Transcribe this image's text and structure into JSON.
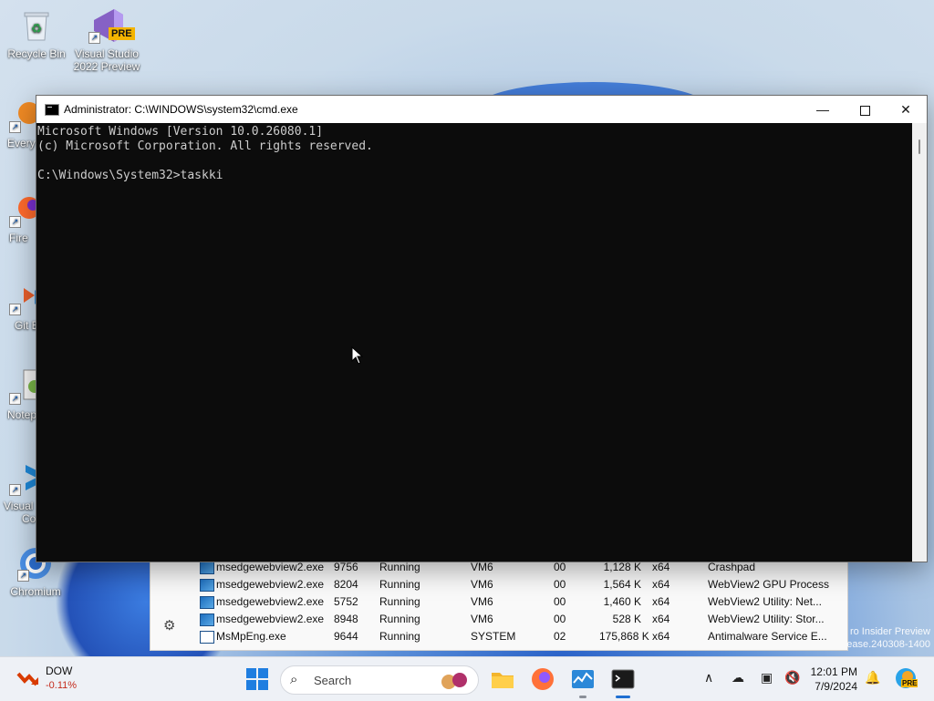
{
  "desktop": {
    "icons": [
      {
        "label": "Recycle Bin"
      },
      {
        "label": "Visual Studio 2022 Preview",
        "badge": "PRE"
      },
      {
        "label": "Every"
      },
      {
        "label": "Fire"
      },
      {
        "label": "Git E"
      },
      {
        "label": "Notep"
      },
      {
        "label": "Visual",
        "label2": "Co"
      },
      {
        "label": "Chromium"
      }
    ]
  },
  "cmd": {
    "title": "Administrator: C:\\WINDOWS\\system32\\cmd.exe",
    "lines": [
      "Microsoft Windows [Version 10.0.26080.1]",
      "(c) Microsoft Corporation. All rights reserved.",
      "",
      "C:\\Windows\\System32>taskki"
    ],
    "controls": {
      "minimize": "—",
      "close": "✕"
    }
  },
  "taskmgr": {
    "rows": [
      {
        "name": "msedgewebview2.exe",
        "pid": "9756",
        "status": "Running",
        "user": "VM6",
        "cpu": "00",
        "mem": "1,128 K",
        "arch": "x64",
        "desc": "Crashpad"
      },
      {
        "name": "msedgewebview2.exe",
        "pid": "8204",
        "status": "Running",
        "user": "VM6",
        "cpu": "00",
        "mem": "1,564 K",
        "arch": "x64",
        "desc": "WebView2 GPU Process"
      },
      {
        "name": "msedgewebview2.exe",
        "pid": "5752",
        "status": "Running",
        "user": "VM6",
        "cpu": "00",
        "mem": "1,460 K",
        "arch": "x64",
        "desc": "WebView2 Utility: Net..."
      },
      {
        "name": "msedgewebview2.exe",
        "pid": "8948",
        "status": "Running",
        "user": "VM6",
        "cpu": "00",
        "mem": "528 K",
        "arch": "x64",
        "desc": "WebView2 Utility: Stor..."
      },
      {
        "name": "MsMpEng.exe",
        "pid": "9644",
        "status": "Running",
        "user": "SYSTEM",
        "cpu": "02",
        "mem": "175,868 K",
        "arch": "x64",
        "desc": "Antimalware Service E..."
      }
    ]
  },
  "watermark": {
    "line1": "ro Insider Preview",
    "line2": "ease.240308-1400"
  },
  "taskbar": {
    "widget": {
      "title": "DOW",
      "change": "-0.11%"
    },
    "search_placeholder": "Search",
    "clock": {
      "time": "12:01 PM",
      "date": "7/9/2024"
    },
    "copilot_badge": "PRE"
  }
}
